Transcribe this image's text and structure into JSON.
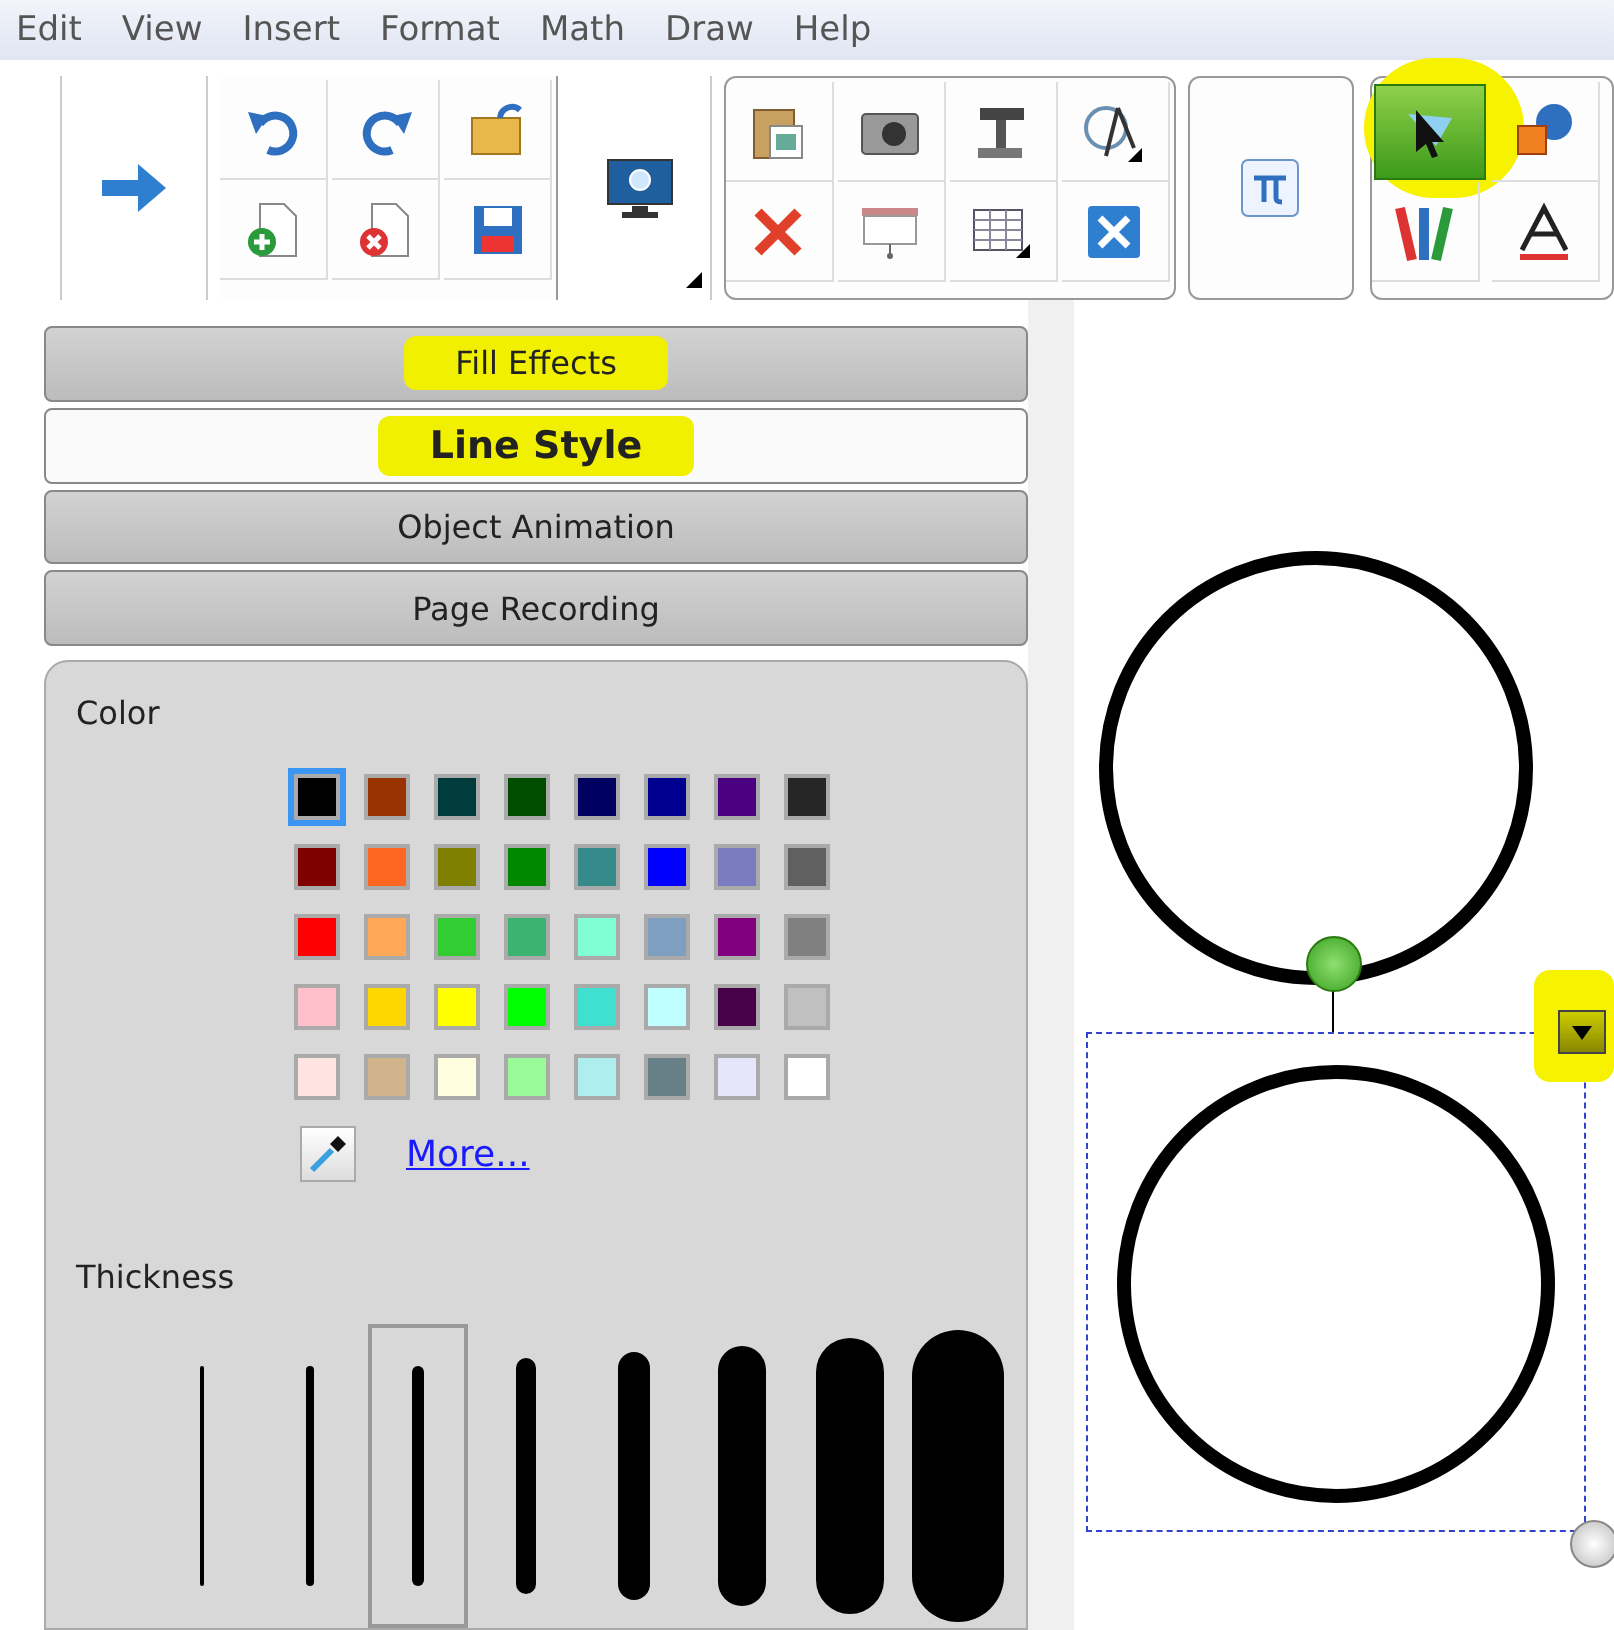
{
  "menu": [
    "Edit",
    "View",
    "Insert",
    "Format",
    "Math",
    "Draw",
    "Help"
  ],
  "select_tool": {
    "selected": true,
    "highlighted": true
  },
  "tabs": [
    {
      "label": "Fill Effects",
      "selected": false,
      "highlighted": true
    },
    {
      "label": "Line Style",
      "selected": true,
      "highlighted": true
    },
    {
      "label": "Object Animation",
      "selected": false,
      "highlighted": false
    },
    {
      "label": "Page Recording",
      "selected": false,
      "highlighted": false
    }
  ],
  "color_section": {
    "title": "Color",
    "more_link": "More...",
    "swatches": [
      {
        "color": "#000000",
        "selected": true
      },
      {
        "color": "#993300",
        "selected": false
      },
      {
        "color": "#003c3c",
        "selected": false
      },
      {
        "color": "#004d00",
        "selected": false
      },
      {
        "color": "#000060",
        "selected": false
      },
      {
        "color": "#000090",
        "selected": false
      },
      {
        "color": "#4b0082",
        "selected": false
      },
      {
        "color": "#262626",
        "selected": false
      },
      {
        "color": "#800000",
        "selected": false
      },
      {
        "color": "#ff6622",
        "selected": false
      },
      {
        "color": "#808000",
        "selected": false
      },
      {
        "color": "#008800",
        "selected": false
      },
      {
        "color": "#358a8a",
        "selected": false
      },
      {
        "color": "#0000ff",
        "selected": false
      },
      {
        "color": "#7b7bc0",
        "selected": false
      },
      {
        "color": "#606060",
        "selected": false
      },
      {
        "color": "#ff0000",
        "selected": false
      },
      {
        "color": "#ffa858",
        "selected": false
      },
      {
        "color": "#32cd32",
        "selected": false
      },
      {
        "color": "#3cb371",
        "selected": false
      },
      {
        "color": "#80ffd4",
        "selected": false
      },
      {
        "color": "#7f9fc0",
        "selected": false
      },
      {
        "color": "#800080",
        "selected": false
      },
      {
        "color": "#808080",
        "selected": false
      },
      {
        "color": "#ffc0cb",
        "selected": false
      },
      {
        "color": "#ffd700",
        "selected": false
      },
      {
        "color": "#ffff00",
        "selected": false
      },
      {
        "color": "#00ff00",
        "selected": false
      },
      {
        "color": "#40e0d0",
        "selected": false
      },
      {
        "color": "#c0ffff",
        "selected": false
      },
      {
        "color": "#480048",
        "selected": false
      },
      {
        "color": "#c0c0c0",
        "selected": false
      },
      {
        "color": "#ffe4e1",
        "selected": false
      },
      {
        "color": "#d2b48c",
        "selected": false
      },
      {
        "color": "#ffffe0",
        "selected": false
      },
      {
        "color": "#98fb98",
        "selected": false
      },
      {
        "color": "#afeeee",
        "selected": false
      },
      {
        "color": "#678088",
        "selected": false
      },
      {
        "color": "#e6e6fa",
        "selected": false
      },
      {
        "color": "#ffffff",
        "selected": false
      }
    ]
  },
  "thickness_section": {
    "title": "Thickness",
    "options": [
      {
        "selected": false
      },
      {
        "selected": false
      },
      {
        "selected": true
      },
      {
        "selected": false
      },
      {
        "selected": false
      },
      {
        "selected": false
      },
      {
        "selected": false
      },
      {
        "selected": false
      }
    ]
  },
  "canvas": {
    "object_menu": {
      "highlighted": true
    }
  }
}
